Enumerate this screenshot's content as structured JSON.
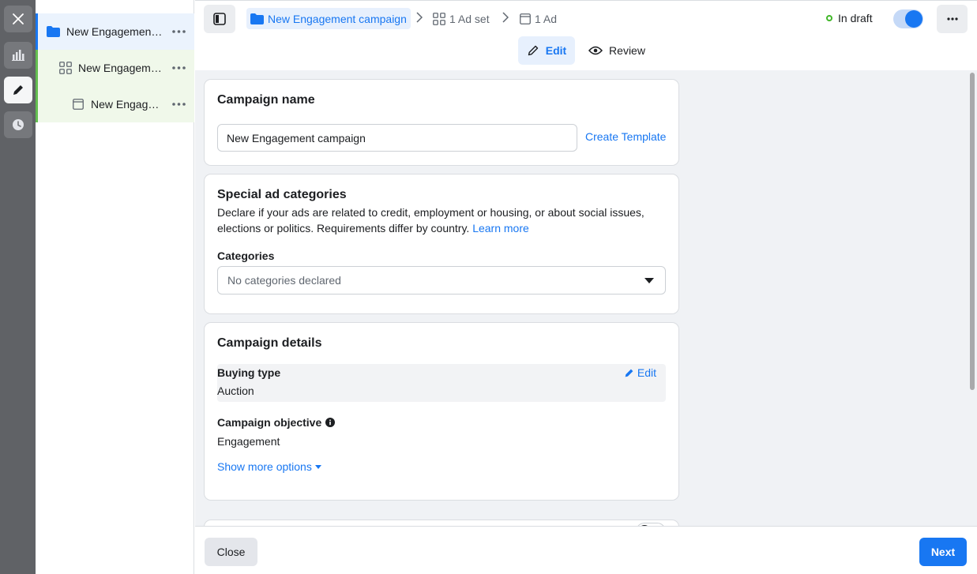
{
  "rail": {
    "icons": [
      "close-icon",
      "chart-icon",
      "pencil-icon",
      "clock-icon"
    ]
  },
  "tree": {
    "items": [
      {
        "label": "New Engagement campaign",
        "icon": "folder-icon"
      },
      {
        "label": "New Engagement ad set",
        "icon": "grid-icon"
      },
      {
        "label": "New Engagement ad",
        "icon": "ad-icon"
      }
    ]
  },
  "header": {
    "breadcrumb": {
      "campaign": "New Engagement campaign",
      "adset": "1 Ad set",
      "ad": "1 Ad"
    },
    "status": "In draft",
    "tabs": {
      "edit": "Edit",
      "review": "Review"
    }
  },
  "campaign_name": {
    "title": "Campaign name",
    "value": "New Engagement campaign",
    "create_template": "Create Template"
  },
  "special_ad": {
    "title": "Special ad categories",
    "description": "Declare if your ads are related to credit, employment or housing, or about social issues, elections or politics. Requirements differ by country.",
    "learn_more": "Learn more",
    "categories_label": "Categories",
    "categories_placeholder": "No categories declared"
  },
  "campaign_details": {
    "title": "Campaign details",
    "buying_type_label": "Buying type",
    "buying_type_value": "Auction",
    "edit_label": "Edit",
    "objective_label": "Campaign objective",
    "objective_value": "Engagement",
    "show_more": "Show more options"
  },
  "footer": {
    "close": "Close",
    "next": "Next"
  },
  "colors": {
    "accent": "#1877f2",
    "draft_green": "#42b72a"
  }
}
